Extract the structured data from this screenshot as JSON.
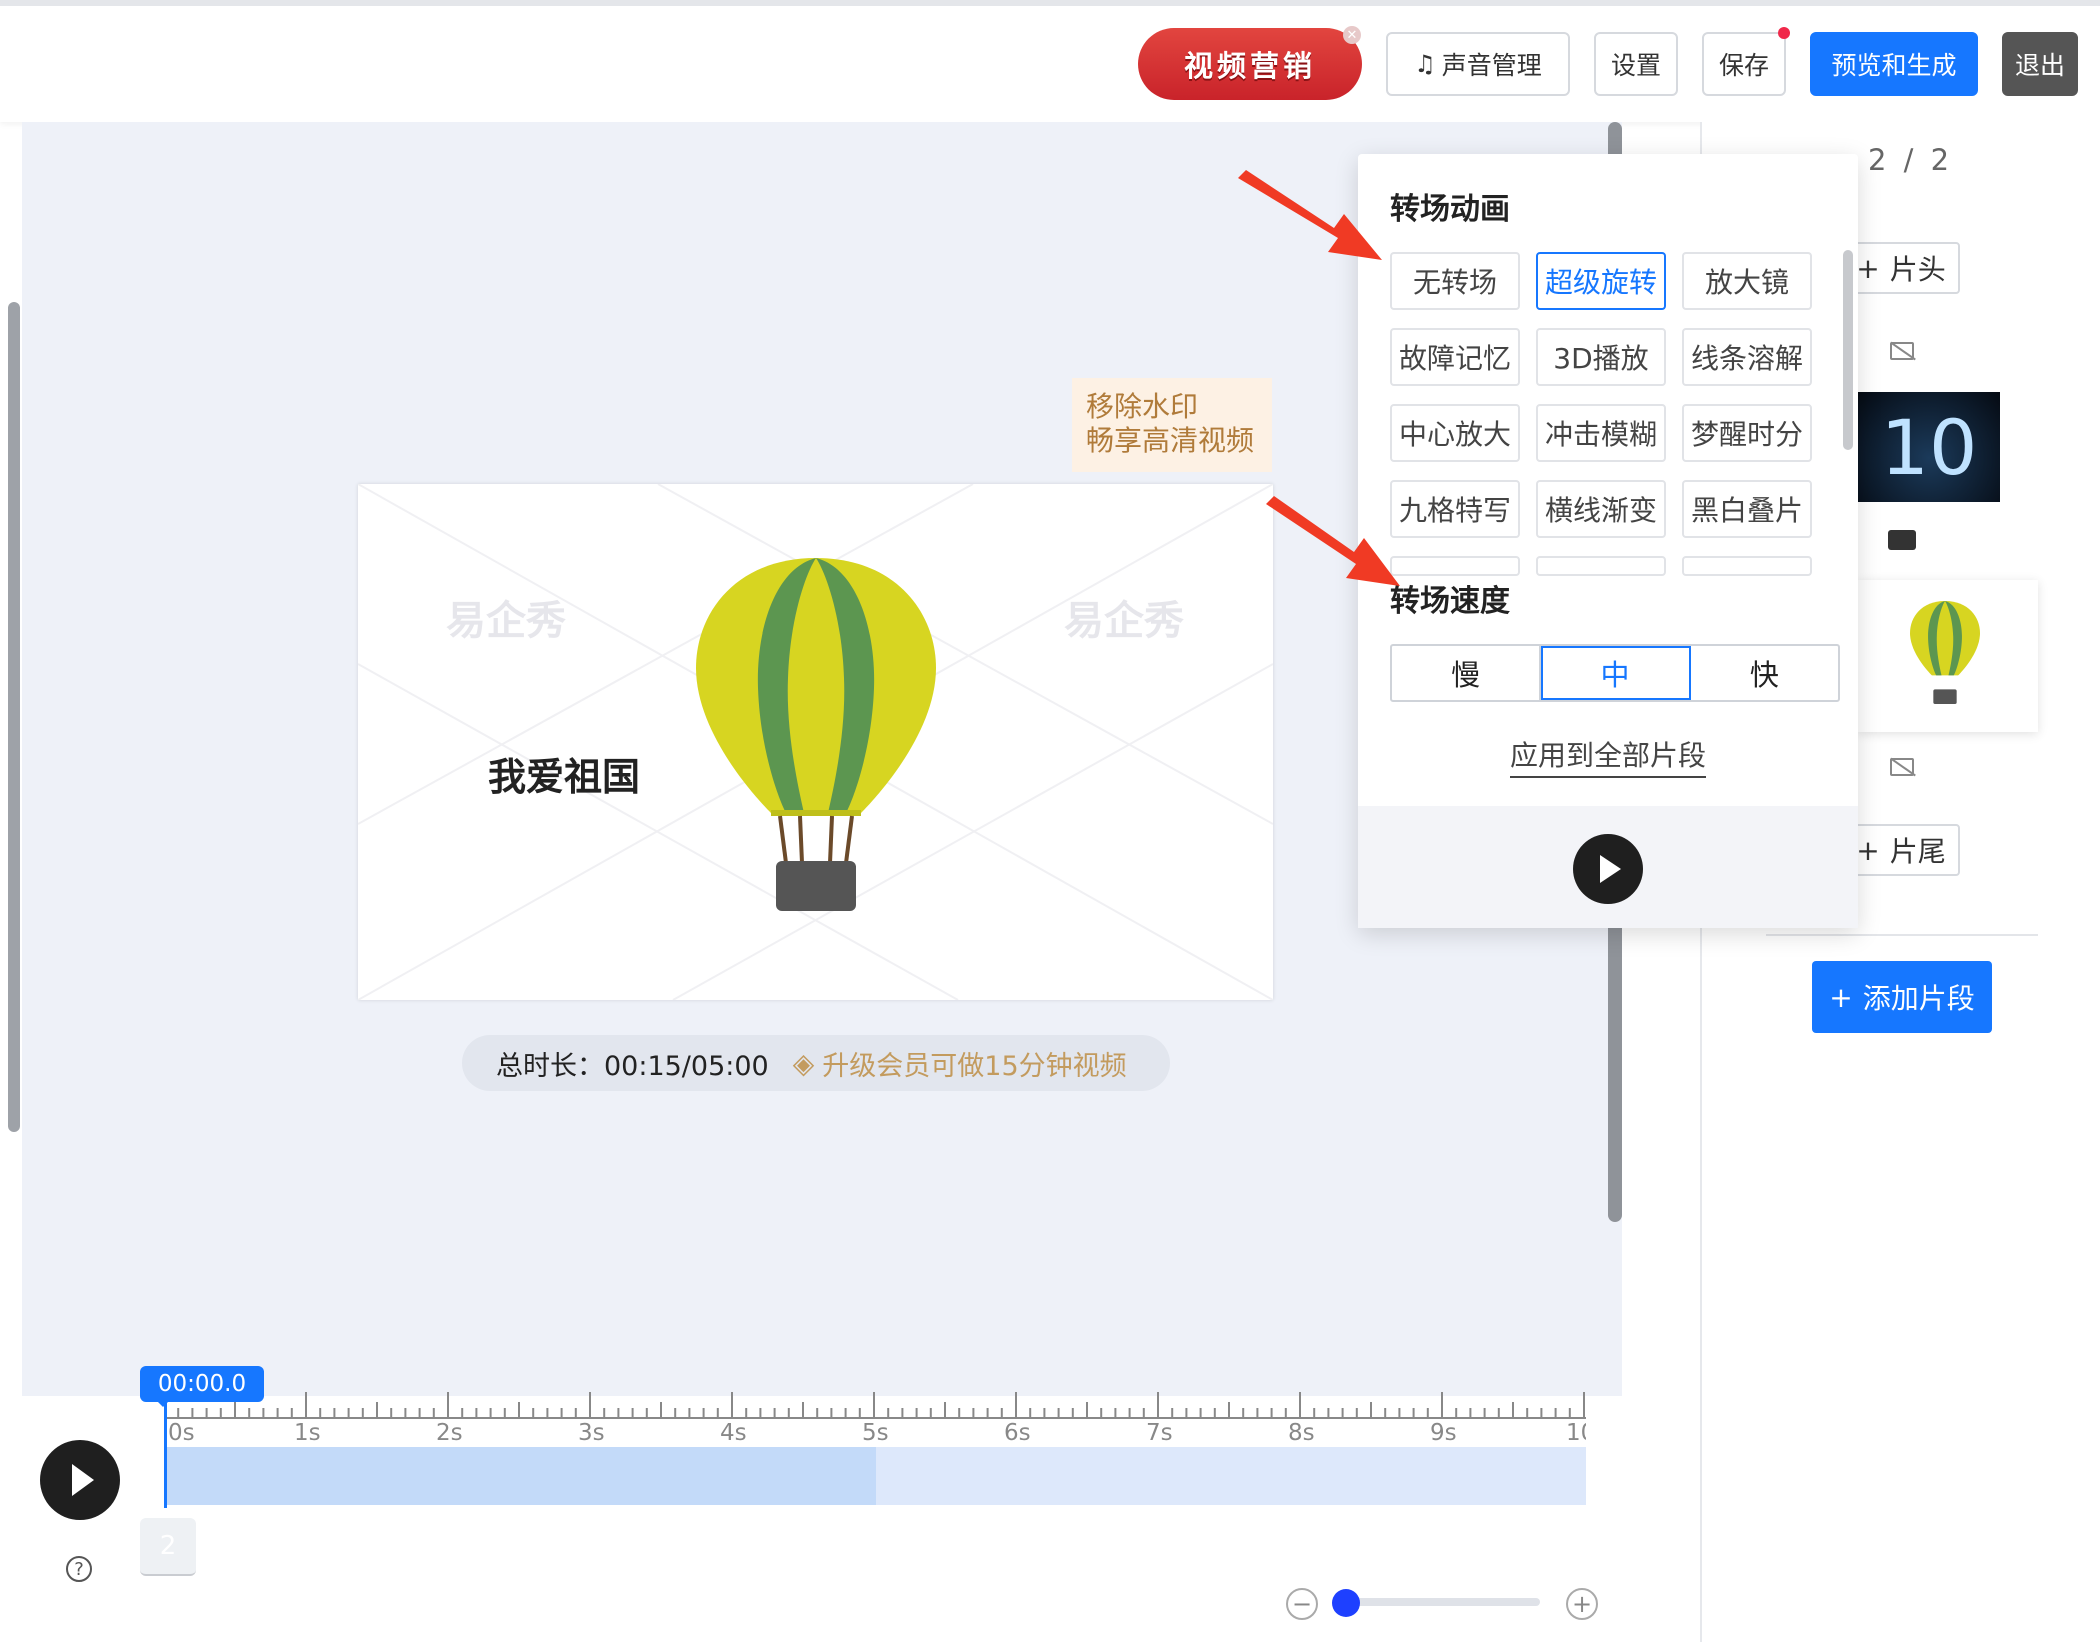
{
  "topbar": {
    "promo_label": "视频营销",
    "sound_label": "声音管理",
    "settings_label": "设置",
    "save_label": "保存",
    "preview_label": "预览和生成",
    "exit_label": "退出"
  },
  "stage": {
    "video_title": "我爱祖国",
    "watermark": "易企秀",
    "vip_line1": "移除水印",
    "vip_line2": "畅享高清视频",
    "duration_label": "总时长：00:15/05:00",
    "upgrade_label": "升级会员可做15分钟视频"
  },
  "timeline": {
    "current_time": "00:00.0",
    "ticks": [
      "0s",
      "1s",
      "2s",
      "3s",
      "4s",
      "5s",
      "6s",
      "7s",
      "8s",
      "9s",
      "10"
    ],
    "clip_number": "2",
    "help": "?"
  },
  "right_panel": {
    "page_indicator": "2 / 2",
    "intro_label": "片头",
    "outro_label": "片尾",
    "add_clip_label": "添加片段",
    "thumb_text": "10"
  },
  "popup": {
    "transition_title": "转场动画",
    "transitions": [
      "无转场",
      "超级旋转",
      "放大镜",
      "故障记忆",
      "3D播放",
      "线条溶解",
      "中心放大",
      "冲击模糊",
      "梦醒时分",
      "九格特写",
      "横线渐变",
      "黑白叠片"
    ],
    "active_transition": "超级旋转",
    "speed_title": "转场速度",
    "speeds": [
      "慢",
      "中",
      "快"
    ],
    "active_speed": "中",
    "apply_all_label": "应用到全部片段"
  },
  "colors": {
    "primary": "#1677ff",
    "promo_red": "#d42e2e",
    "gold": "#c39b5e",
    "arrow_red": "#f03a24"
  }
}
